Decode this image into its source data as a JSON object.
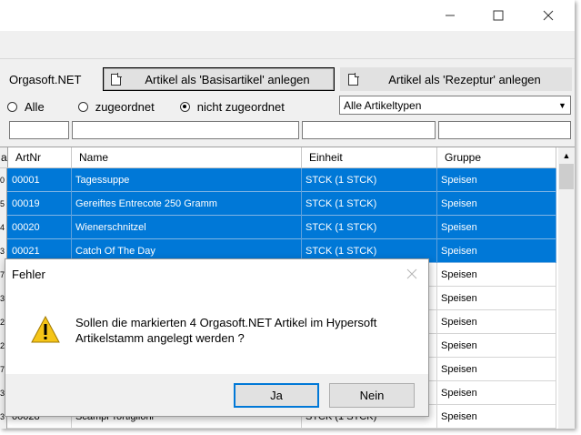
{
  "window": {
    "minimize_icon": "minimize-icon",
    "maximize_icon": "maximize-icon",
    "close_icon": "close-icon"
  },
  "toolbar": {
    "label": "Orgasoft.NET",
    "basis_button": "Artikel als 'Basisartikel' anlegen",
    "rezeptur_button": "Artikel als 'Rezeptur' anlegen"
  },
  "filter": {
    "radio_all": "Alle",
    "radio_assigned": "zugeordnet",
    "radio_unassigned": "nicht zugeordnet",
    "selected_radio": "nicht zugeordnet",
    "type_select": "Alle Artikeltypen"
  },
  "grid": {
    "columns": [
      "ArtNr",
      "Name",
      "Einheit",
      "Gruppe"
    ],
    "rows": [
      {
        "ind": "0",
        "artnr": "00001",
        "name": "Tagessuppe",
        "einheit": "STCK (1 STCK)",
        "gruppe": "Speisen",
        "selected": true
      },
      {
        "ind": "5",
        "artnr": "00019",
        "name": "Gereiftes Entrecote 250 Gramm",
        "einheit": "STCK (1 STCK)",
        "gruppe": "Speisen",
        "selected": true
      },
      {
        "ind": "4",
        "artnr": "00020",
        "name": "Wienerschnitzel",
        "einheit": "STCK (1 STCK)",
        "gruppe": "Speisen",
        "selected": true
      },
      {
        "ind": "3",
        "artnr": "00021",
        "name": "Catch Of The Day",
        "einheit": "STCK (1 STCK)",
        "gruppe": "Speisen",
        "selected": true
      },
      {
        "ind": "7",
        "artnr": "",
        "name": "",
        "einheit": "",
        "gruppe": "Speisen",
        "selected": false
      },
      {
        "ind": "3",
        "artnr": "",
        "name": "",
        "einheit": "",
        "gruppe": "Speisen",
        "selected": false
      },
      {
        "ind": "2",
        "artnr": "",
        "name": "",
        "einheit": "",
        "gruppe": "Speisen",
        "selected": false
      },
      {
        "ind": "2",
        "artnr": "",
        "name": "",
        "einheit": "",
        "gruppe": "Speisen",
        "selected": false
      },
      {
        "ind": "7",
        "artnr": "",
        "name": "",
        "einheit": "",
        "gruppe": "Speisen",
        "selected": false
      },
      {
        "ind": "3",
        "artnr": "",
        "name": "",
        "einheit": "",
        "gruppe": "Speisen",
        "selected": false
      },
      {
        "ind": "3",
        "artnr": "00028",
        "name": "Scampi Tortiglioni",
        "einheit": "STCK (1 STCK)",
        "gruppe": "Speisen",
        "selected": false
      }
    ]
  },
  "dialog": {
    "title": "Fehler",
    "icon": "warning-icon",
    "message_line1": "Sollen die markierten 4 Orgasoft.NET Artikel im Hypersoft",
    "message_line2": "Artikelstamm angelegt werden ?",
    "yes": "Ja",
    "no": "Nein"
  },
  "colors": {
    "selection": "#0078d7",
    "window_bg": "#f0f0f0",
    "warning": "#f5c518"
  }
}
